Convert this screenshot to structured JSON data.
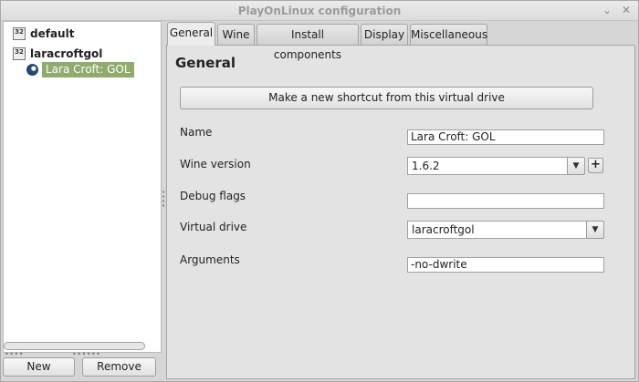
{
  "window": {
    "title": "PlayOnLinux configuration",
    "minimize_glyph": "⌄",
    "close_glyph": "✕"
  },
  "tree": {
    "items": [
      {
        "label": "default",
        "icon": "32"
      },
      {
        "label": "laracroftgol",
        "icon": "32"
      }
    ],
    "child": {
      "label": "Lara Croft:  GOL",
      "icon": "steam-icon",
      "selected": true,
      "highlight_color": "#8fab6e"
    }
  },
  "buttons": {
    "new": "New",
    "remove": "Remove"
  },
  "tabs": [
    {
      "label": "General",
      "active": true
    },
    {
      "label": "Wine",
      "active": false
    },
    {
      "label": "Install components",
      "active": false
    },
    {
      "label": "Display",
      "active": false
    },
    {
      "label": "Miscellaneous",
      "active": false
    }
  ],
  "general": {
    "heading": "General",
    "shortcut_button": "Make a new shortcut from this virtual drive",
    "fields": {
      "name": {
        "label": "Name",
        "value": "Lara Croft:  GOL"
      },
      "wine_version": {
        "label": "Wine version",
        "value": "1.6.2"
      },
      "debug_flags": {
        "label": "Debug flags",
        "value": ""
      },
      "virtual_drive": {
        "label": "Virtual drive",
        "value": "laracroftgol"
      },
      "arguments": {
        "label": "Arguments",
        "value": "-no-dwrite"
      }
    }
  }
}
